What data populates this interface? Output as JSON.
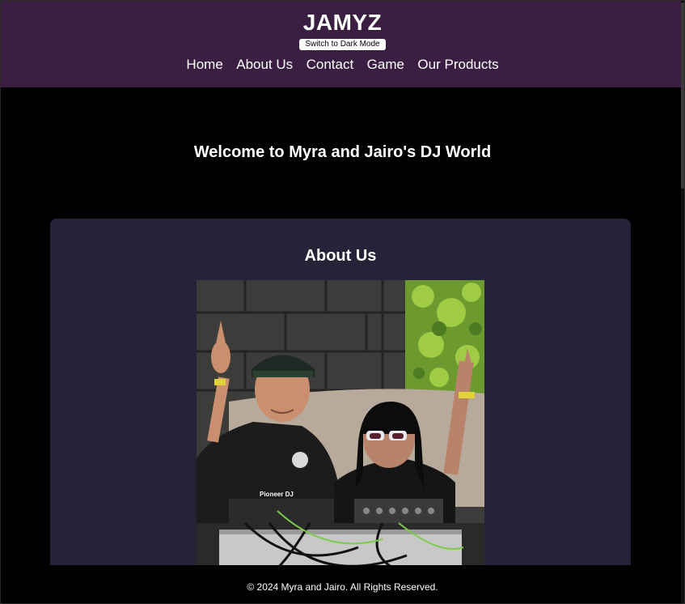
{
  "header": {
    "title": "JAMYZ",
    "theme_toggle_label": "Switch to Dark Mode",
    "nav": [
      {
        "label": "Home"
      },
      {
        "label": "About Us"
      },
      {
        "label": "Contact"
      },
      {
        "label": "Game"
      },
      {
        "label": "Our Products"
      }
    ]
  },
  "main": {
    "welcome": "Welcome to Myra and Jairo's DJ World",
    "about": {
      "title": "About Us",
      "photo_dj_label": "Pioneer DJ"
    }
  },
  "footer": {
    "copyright": "© 2024 Myra and Jairo. All Rights Reserved."
  },
  "colors": {
    "header_bg": "#3a1f42",
    "page_bg": "#000000",
    "card_bg": "#262237",
    "text": "#ffffff"
  }
}
